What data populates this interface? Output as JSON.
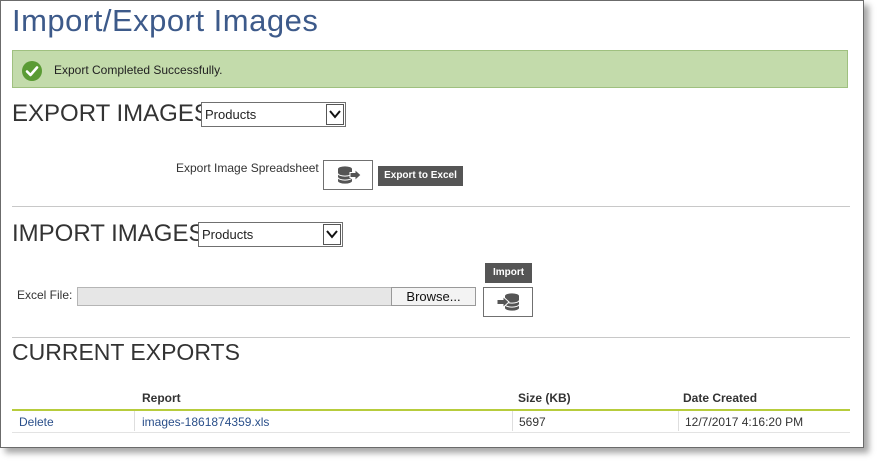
{
  "page": {
    "title": "Import/Export Images"
  },
  "alert": {
    "message": "Export Completed Successfully.",
    "color": "#c3dbab"
  },
  "export_section": {
    "title": "EXPORT IMAGES",
    "select_value": "Products",
    "spreadsheet_label": "Export Image Spreadsheet",
    "export_button_label": "Export to Excel"
  },
  "import_section": {
    "title": "IMPORT IMAGES",
    "select_value": "Products",
    "excel_file_label": "Excel File:",
    "browse_label": "Browse...",
    "import_button_label": "Import"
  },
  "exports": {
    "title": "CURRENT EXPORTS",
    "columns": [
      "Report",
      "Size (KB)",
      "Date Created"
    ],
    "rows": [
      {
        "action": "Delete",
        "report": "images-1861874359.xls",
        "size": "5697",
        "date": "12/7/2017 4:16:20 PM"
      }
    ]
  },
  "icons": {
    "success": "check-circle-icon",
    "export": "database-export-icon",
    "import": "database-import-icon",
    "dropdown": "chevron-down-icon"
  }
}
